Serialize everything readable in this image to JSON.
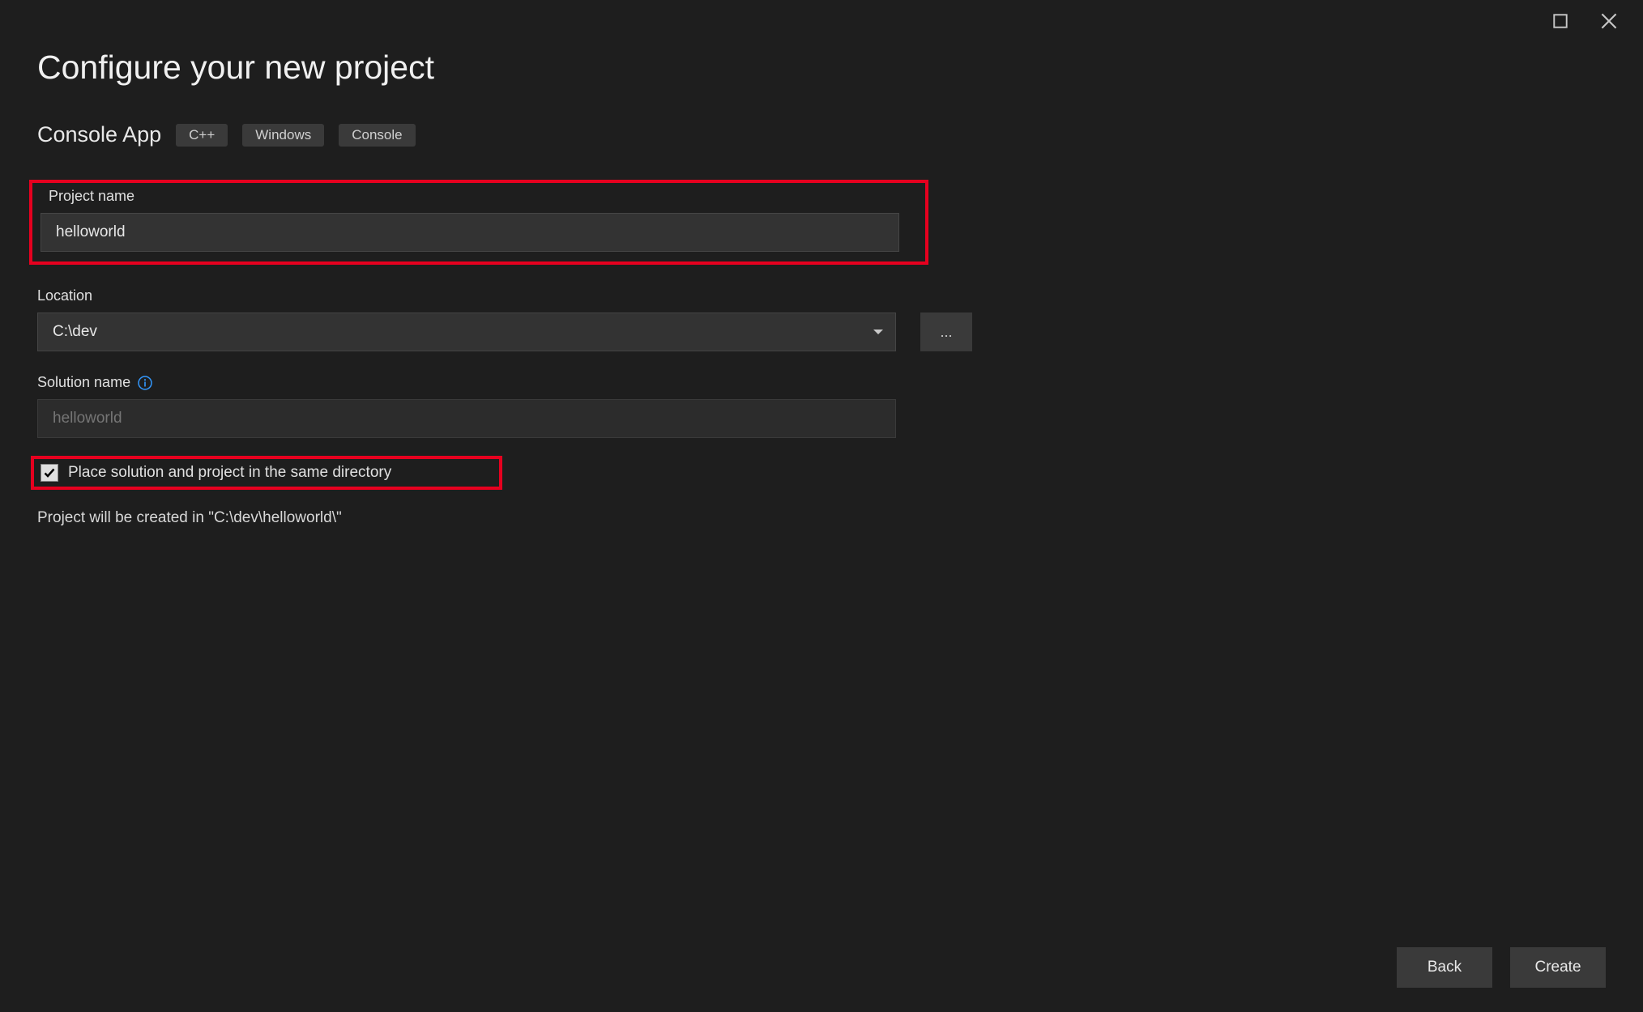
{
  "window": {
    "maximize_label": "Maximize",
    "close_label": "Close"
  },
  "header": {
    "title": "Configure your new project"
  },
  "template": {
    "name": "Console App",
    "tags": [
      "C++",
      "Windows",
      "Console"
    ]
  },
  "fields": {
    "project_name": {
      "label": "Project name",
      "value": "helloworld"
    },
    "location": {
      "label": "Location",
      "value": "C:\\dev",
      "browse_label": "..."
    },
    "solution_name": {
      "label": "Solution name",
      "placeholder": "helloworld"
    },
    "same_dir_checkbox": {
      "label": "Place solution and project in the same directory",
      "checked": true
    }
  },
  "path_note": "Project will be created in \"C:\\dev\\helloworld\\\"",
  "footer": {
    "back_label": "Back",
    "create_label": "Create"
  }
}
